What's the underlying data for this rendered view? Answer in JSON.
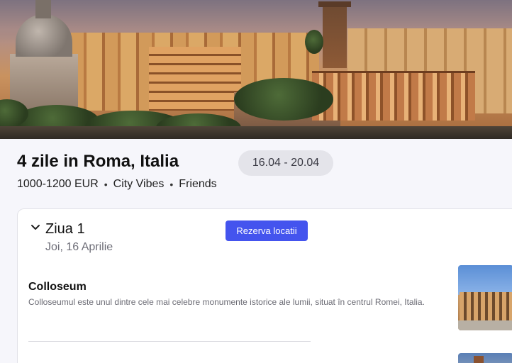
{
  "trip": {
    "title": "4 zile in Roma, Italia",
    "dates": "16.04 - 20.04",
    "budget": "1000-1200 EUR",
    "vibe": "City Vibes",
    "company": "Friends",
    "separator": "•"
  },
  "day": {
    "title": "Ziua 1",
    "date": "Joi, 16 Aprilie",
    "book_label": "Rezerva locatii",
    "expand_icon": "chevron-down-icon"
  },
  "places": [
    {
      "name": "Colloseum",
      "description": "Colloseumul este unul dintre cele mai celebre monumente istorice ale lumii, situat în centrul Romei, Italia."
    }
  ]
}
